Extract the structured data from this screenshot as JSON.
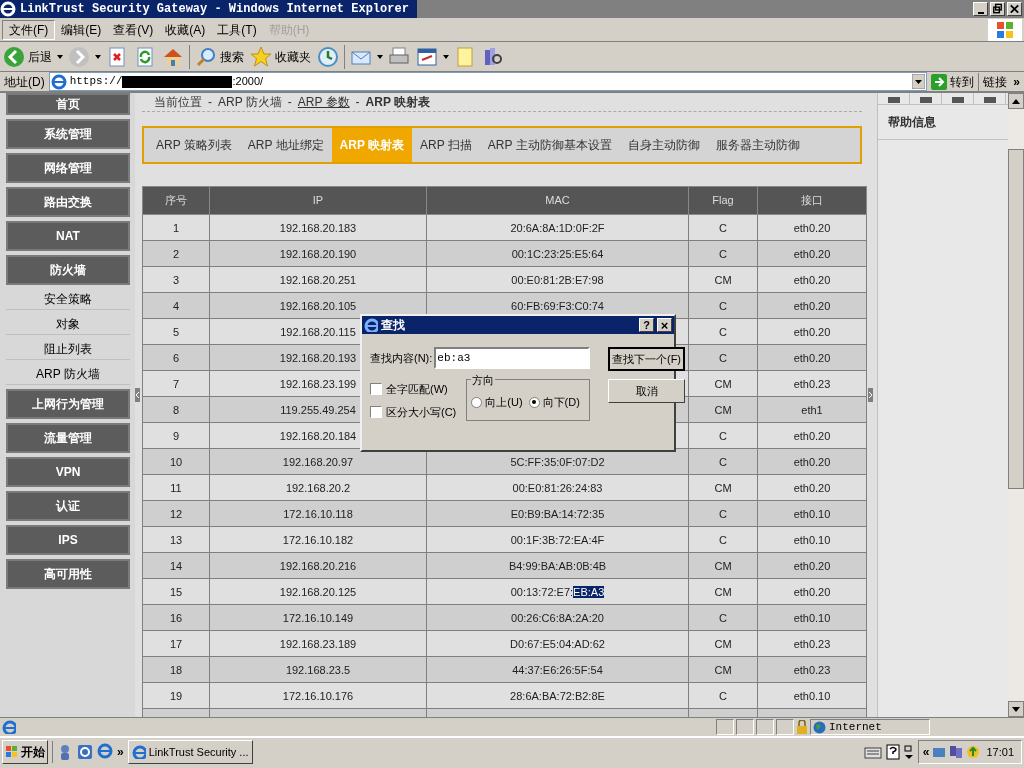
{
  "window": {
    "title": "LinkTrust Security Gateway - Windows Internet Explorer"
  },
  "menu": [
    {
      "label": "文件(F)",
      "selected": true,
      "disabled": false
    },
    {
      "label": "编辑(E)",
      "selected": false,
      "disabled": false
    },
    {
      "label": "查看(V)",
      "selected": false,
      "disabled": false
    },
    {
      "label": "收藏(A)",
      "selected": false,
      "disabled": false
    },
    {
      "label": "工具(T)",
      "selected": false,
      "disabled": false
    },
    {
      "label": "帮助(H)",
      "selected": false,
      "disabled": true
    }
  ],
  "toolbar": {
    "back": "后退",
    "search": "搜索",
    "favorites": "收藏夹"
  },
  "address": {
    "label": "地址(D)",
    "url_start": "https://",
    "url_end": ":2000/",
    "go": "转到",
    "links": "链接",
    "more": "»"
  },
  "sidebar": [
    {
      "label": "首页",
      "kind": "nav"
    },
    {
      "label": "系统管理",
      "kind": "nav"
    },
    {
      "label": "网络管理",
      "kind": "nav"
    },
    {
      "label": "路由交换",
      "kind": "nav"
    },
    {
      "label": "NAT",
      "kind": "nav"
    },
    {
      "label": "防火墙",
      "kind": "nav"
    },
    {
      "label": "安全策略",
      "kind": "sub"
    },
    {
      "label": "对象",
      "kind": "sub"
    },
    {
      "label": "阻止列表",
      "kind": "sub"
    },
    {
      "label": "ARP 防火墙",
      "kind": "sub"
    },
    {
      "label": "上网行为管理",
      "kind": "nav"
    },
    {
      "label": "流量管理",
      "kind": "nav"
    },
    {
      "label": "VPN",
      "kind": "nav"
    },
    {
      "label": "认证",
      "kind": "nav"
    },
    {
      "label": "IPS",
      "kind": "nav"
    },
    {
      "label": "高可用性",
      "kind": "nav"
    }
  ],
  "breadcrumb": [
    {
      "label": "当前位置",
      "kind": "text"
    },
    {
      "label": "-",
      "kind": "separator"
    },
    {
      "label": "ARP 防火墙",
      "kind": "text"
    },
    {
      "label": "-",
      "kind": "separator"
    },
    {
      "label": "ARP 参数",
      "kind": "link"
    },
    {
      "label": "-",
      "kind": "separator"
    },
    {
      "label": "ARP 映射表",
      "kind": "current"
    }
  ],
  "tabs": [
    {
      "label": "ARP 策略列表",
      "selected": false
    },
    {
      "label": "ARP 地址绑定",
      "selected": false
    },
    {
      "label": "ARP 映射表",
      "selected": true
    },
    {
      "label": "ARP 扫描",
      "selected": false
    },
    {
      "label": "ARP 主动防御基本设置",
      "selected": false
    },
    {
      "label": "自身主动防御",
      "selected": false
    },
    {
      "label": "服务器主动防御",
      "selected": false
    }
  ],
  "table": {
    "columns": [
      "序号",
      "IP",
      "MAC",
      "Flag",
      "接口"
    ],
    "rows": [
      {
        "no": "1",
        "ip": "192.168.20.183",
        "mac": "20:6A:8A:1D:0F:2F",
        "flag": "C",
        "iface": "eth0.20"
      },
      {
        "no": "2",
        "ip": "192.168.20.190",
        "mac": "00:1C:23:25:E5:64",
        "flag": "C",
        "iface": "eth0.20"
      },
      {
        "no": "3",
        "ip": "192.168.20.251",
        "mac": "00:E0:81:2B:E7:98",
        "flag": "CM",
        "iface": "eth0.20"
      },
      {
        "no": "4",
        "ip": "192.168.20.105",
        "mac": "60:FB:69:F3:C0:74",
        "flag": "C",
        "iface": "eth0.20"
      },
      {
        "no": "5",
        "ip": "192.168.20.115",
        "flag": "C",
        "iface": "eth0.20"
      },
      {
        "no": "6",
        "ip": "192.168.20.193",
        "flag": "C",
        "iface": "eth0.20"
      },
      {
        "no": "7",
        "ip": "192.168.23.199",
        "flag": "CM",
        "iface": "eth0.23"
      },
      {
        "no": "8",
        "ip": "119.255.49.254",
        "flag": "CM",
        "iface": "eth1"
      },
      {
        "no": "9",
        "ip": "192.168.20.184",
        "flag": "C",
        "iface": "eth0.20"
      },
      {
        "no": "10",
        "ip": "192.168.20.97",
        "mac": "5C:FF:35:0F:07:D2",
        "flag": "C",
        "iface": "eth0.20"
      },
      {
        "no": "11",
        "ip": "192.168.20.2",
        "mac": "00:E0:81:26:24:83",
        "flag": "CM",
        "iface": "eth0.20"
      },
      {
        "no": "12",
        "ip": "172.16.10.118",
        "mac": "E0:B9:BA:14:72:35",
        "flag": "C",
        "iface": "eth0.10"
      },
      {
        "no": "13",
        "ip": "172.16.10.182",
        "mac": "00:1F:3B:72:EA:4F",
        "flag": "C",
        "iface": "eth0.10"
      },
      {
        "no": "14",
        "ip": "192.168.20.216",
        "mac": "B4:99:BA:AB:0B:4B",
        "flag": "CM",
        "iface": "eth0.20"
      },
      {
        "no": "15",
        "ip": "192.168.20.125",
        "mac": "00:13:72:E7:",
        "mac_selected": "EB:A3",
        "flag": "CM",
        "iface": "eth0.20"
      },
      {
        "no": "16",
        "ip": "172.16.10.149",
        "mac": "00:26:C6:8A:2A:20",
        "flag": "C",
        "iface": "eth0.10"
      },
      {
        "no": "17",
        "ip": "192.168.23.189",
        "mac": "D0:67:E5:04:AD:62",
        "flag": "CM",
        "iface": "eth0.23"
      },
      {
        "no": "18",
        "ip": "192.168.23.5",
        "mac": "44:37:E6:26:5F:54",
        "flag": "CM",
        "iface": "eth0.23"
      },
      {
        "no": "19",
        "ip": "172.16.10.176",
        "mac": "28:6A:BA:72:B2:8E",
        "flag": "C",
        "iface": "eth0.10"
      }
    ]
  },
  "help_panel": {
    "title": "帮助信息"
  },
  "find_dialog": {
    "title": "查找",
    "help": "?",
    "close": "×",
    "find_label": "查找内容(N):",
    "find_value": "eb:a3",
    "options": [
      {
        "label": "全字匹配(W)",
        "checked": false
      },
      {
        "label": "区分大小写(C)",
        "checked": false
      }
    ],
    "direction": {
      "label": "方向",
      "choices": [
        {
          "label": "向上(U)",
          "selected": false
        },
        {
          "label": "向下(D)",
          "selected": true
        }
      ]
    },
    "buttons": [
      {
        "label": "查找下一个(F)",
        "default": true
      },
      {
        "label": "取消",
        "default": false
      }
    ]
  },
  "status_bar": {
    "zone": "Internet"
  },
  "taskbar": {
    "start": "开始",
    "more": "»",
    "task": "LinkTrust Security ...",
    "chevron": "«",
    "time": "17:01"
  }
}
